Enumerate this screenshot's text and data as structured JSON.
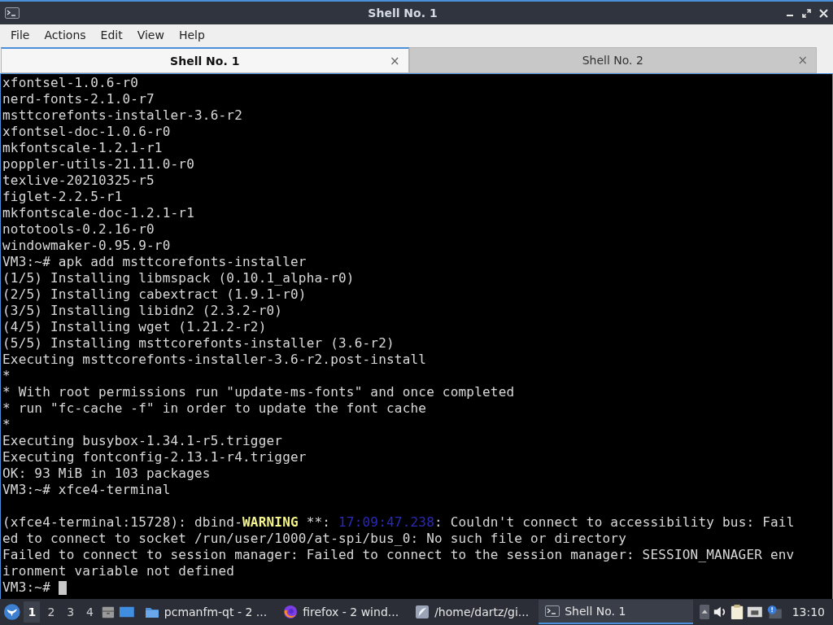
{
  "window": {
    "title": "Shell No. 1"
  },
  "menu": [
    "File",
    "Actions",
    "Edit",
    "View",
    "Help"
  ],
  "tabs": [
    {
      "label": "Shell No. 1",
      "selected": true,
      "close": "×"
    },
    {
      "label": "Shell No. 2",
      "selected": false,
      "close": "×"
    }
  ],
  "terminal": {
    "lines": [
      {
        "kind": "text",
        "segments": [
          {
            "text": "xfontsel-1.0.6-r0",
            "kind": "plain"
          }
        ]
      },
      {
        "kind": "text",
        "segments": [
          {
            "text": "nerd-fonts-2.1.0-r7",
            "kind": "plain"
          }
        ]
      },
      {
        "kind": "text",
        "segments": [
          {
            "text": "msttcorefonts-installer-3.6-r2",
            "kind": "plain"
          }
        ]
      },
      {
        "kind": "text",
        "segments": [
          {
            "text": "xfontsel-doc-1.0.6-r0",
            "kind": "plain"
          }
        ]
      },
      {
        "kind": "text",
        "segments": [
          {
            "text": "mkfontscale-1.2.1-r1",
            "kind": "plain"
          }
        ]
      },
      {
        "kind": "text",
        "segments": [
          {
            "text": "poppler-utils-21.11.0-r0",
            "kind": "plain"
          }
        ]
      },
      {
        "kind": "text",
        "segments": [
          {
            "text": "texlive-20210325-r5",
            "kind": "plain"
          }
        ]
      },
      {
        "kind": "text",
        "segments": [
          {
            "text": "figlet-2.2.5-r1",
            "kind": "plain"
          }
        ]
      },
      {
        "kind": "text",
        "segments": [
          {
            "text": "mkfontscale-doc-1.2.1-r1",
            "kind": "plain"
          }
        ]
      },
      {
        "kind": "text",
        "segments": [
          {
            "text": "nototools-0.2.16-r0",
            "kind": "plain"
          }
        ]
      },
      {
        "kind": "text",
        "segments": [
          {
            "text": "windowmaker-0.95.9-r0",
            "kind": "plain"
          }
        ]
      },
      {
        "kind": "text",
        "segments": [
          {
            "text": "VM3:~# apk add msttcorefonts-installer",
            "kind": "plain"
          }
        ]
      },
      {
        "kind": "text",
        "segments": [
          {
            "text": "(1/5) Installing libmspack (0.10.1_alpha-r0)",
            "kind": "plain"
          }
        ]
      },
      {
        "kind": "text",
        "segments": [
          {
            "text": "(2/5) Installing cabextract (1.9.1-r0)",
            "kind": "plain"
          }
        ]
      },
      {
        "kind": "text",
        "segments": [
          {
            "text": "(3/5) Installing libidn2 (2.3.2-r0)",
            "kind": "plain"
          }
        ]
      },
      {
        "kind": "text",
        "segments": [
          {
            "text": "(4/5) Installing wget (1.21.2-r2)",
            "kind": "plain"
          }
        ]
      },
      {
        "kind": "text",
        "segments": [
          {
            "text": "(5/5) Installing msttcorefonts-installer (3.6-r2)",
            "kind": "plain"
          }
        ]
      },
      {
        "kind": "text",
        "segments": [
          {
            "text": "Executing msttcorefonts-installer-3.6-r2.post-install",
            "kind": "plain"
          }
        ]
      },
      {
        "kind": "text",
        "segments": [
          {
            "text": "*",
            "kind": "plain"
          }
        ]
      },
      {
        "kind": "text",
        "segments": [
          {
            "text": "* With root permissions run \"update-ms-fonts\" and once completed",
            "kind": "plain"
          }
        ]
      },
      {
        "kind": "text",
        "segments": [
          {
            "text": "* run \"fc-cache -f\" in order to update the font cache",
            "kind": "plain"
          }
        ]
      },
      {
        "kind": "text",
        "segments": [
          {
            "text": "*",
            "kind": "plain"
          }
        ]
      },
      {
        "kind": "text",
        "segments": [
          {
            "text": "Executing busybox-1.34.1-r5.trigger",
            "kind": "plain"
          }
        ]
      },
      {
        "kind": "text",
        "segments": [
          {
            "text": "Executing fontconfig-2.13.1-r4.trigger",
            "kind": "plain"
          }
        ]
      },
      {
        "kind": "text",
        "segments": [
          {
            "text": "OK: 93 MiB in 103 packages",
            "kind": "plain"
          }
        ]
      },
      {
        "kind": "text",
        "segments": [
          {
            "text": "VM3:~# xfce4-terminal",
            "kind": "plain"
          }
        ]
      },
      {
        "kind": "blank"
      },
      {
        "kind": "text",
        "segments": [
          {
            "text": "(xfce4-terminal:15728): dbind-",
            "kind": "plain"
          },
          {
            "text": "WARNING",
            "kind": "warning"
          },
          {
            "text": " **: ",
            "kind": "plain"
          },
          {
            "text": "17:09:47.238",
            "kind": "timestamp"
          },
          {
            "text": ": Couldn't connect to accessibility bus: Fail",
            "kind": "plain"
          }
        ]
      },
      {
        "kind": "text",
        "segments": [
          {
            "text": "ed to connect to socket /run/user/1000/at-spi/bus_0: No such file or directory",
            "kind": "plain"
          }
        ]
      },
      {
        "kind": "text",
        "segments": [
          {
            "text": "Failed to connect to session manager: Failed to connect to the session manager: SESSION_MANAGER env",
            "kind": "plain"
          }
        ]
      },
      {
        "kind": "text",
        "segments": [
          {
            "text": "ironment variable not defined",
            "kind": "plain"
          }
        ]
      },
      {
        "kind": "prompt",
        "segments": [
          {
            "text": "VM3:~#",
            "kind": "plain"
          }
        ]
      }
    ]
  },
  "taskbar": {
    "desktops": [
      {
        "label": "1",
        "selected": true
      },
      {
        "label": "2",
        "selected": false
      },
      {
        "label": "3",
        "selected": false
      },
      {
        "label": "4",
        "selected": false
      }
    ],
    "tasks": [
      {
        "label": "pcmanfm-qt - 2 ...",
        "kind": "folder",
        "selected": false
      },
      {
        "label": "firefox - 2 wind...",
        "kind": "browser",
        "selected": false
      },
      {
        "label": "/home/dartz/gi...",
        "kind": "feather",
        "selected": false
      },
      {
        "label": "Shell No. 1",
        "kind": "terminal",
        "selected": true
      }
    ],
    "clock": "13:10"
  }
}
